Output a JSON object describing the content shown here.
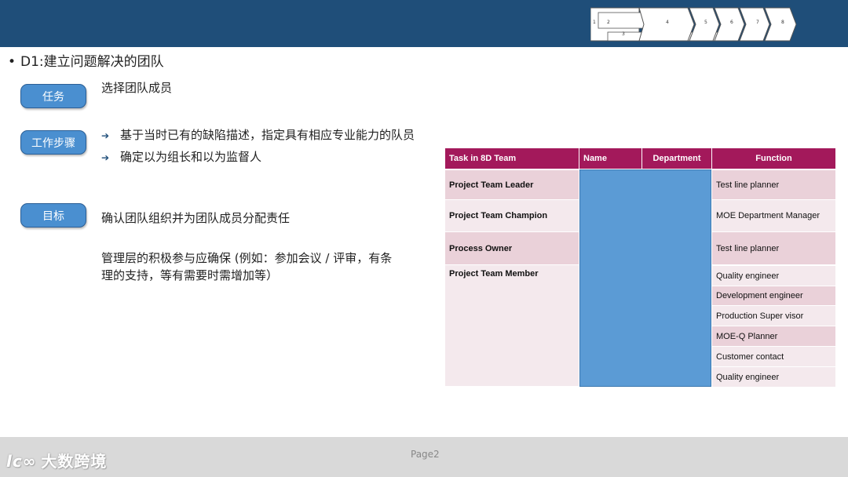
{
  "process_steps": [
    "1",
    "2",
    "3",
    "4",
    "5",
    "6",
    "7",
    "8"
  ],
  "bullet_title": "D1:建立问题解决的团队",
  "sections": {
    "task": {
      "label": "任务",
      "text": "选择团队成员"
    },
    "steps": {
      "label": "工作步骤",
      "items": [
        "基于当时已有的缺陷描述，指定具有相应专业能力的队员",
        "确定以为组长和以为监督人"
      ]
    },
    "goal": {
      "label": "目标",
      "text": "确认团队组织并为团队成员分配责任",
      "text2_line1": "管理层的积极参与应确保 (例如：参加会议 /  评审，有条",
      "text2_line2": "理的支持，等有需要时需增加等）"
    }
  },
  "table": {
    "headers": [
      "Task in 8D Team",
      "Name",
      "Department",
      "Function"
    ],
    "roles": [
      "Project  Team Leader",
      "Project  Team Champion",
      "Process Owner",
      "Project Team Member"
    ],
    "functions": [
      "Test line planner",
      "MOE Department Manager",
      "Test line planner",
      "Quality engineer",
      "Development engineer",
      "Production Super visor",
      "MOE-Q Planner",
      "Customer contact",
      "Quality engineer"
    ]
  },
  "footer": {
    "page": "Page2",
    "watermark": "大数跨境",
    "watermark_logo": "lc∞"
  },
  "colors": {
    "header": "#1f4e79",
    "table_header": "#a3195b",
    "pill": "#4a8fd0",
    "name_col": "#5b9bd5"
  }
}
